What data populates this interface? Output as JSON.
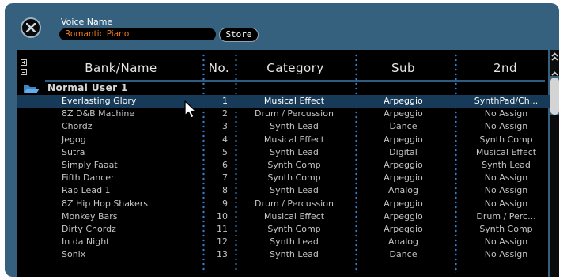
{
  "voice": {
    "label": "Voice Name",
    "value": "Romantic Piano",
    "store_label": "Store"
  },
  "columns": {
    "name": "Bank/Name",
    "no": "No.",
    "category": "Category",
    "sub": "Sub",
    "second": "2nd"
  },
  "group": {
    "label": "Normal User 1"
  },
  "rows": [
    {
      "name": "Everlasting Glory",
      "no": "1",
      "category": "Musical Effect",
      "sub": "Arpeggio",
      "second": "SynthPad/Ch..."
    },
    {
      "name": "8Z D&B Machine",
      "no": "2",
      "category": "Drum / Percussion",
      "sub": "Arpeggio",
      "second": "No Assign"
    },
    {
      "name": "Chordz",
      "no": "3",
      "category": "Synth Lead",
      "sub": "Dance",
      "second": "No Assign"
    },
    {
      "name": "Jegog",
      "no": "4",
      "category": "Musical Effect",
      "sub": "Arpeggio",
      "second": "Synth Comp"
    },
    {
      "name": "Sutra",
      "no": "5",
      "category": "Synth Lead",
      "sub": "Digital",
      "second": "Musical Effect"
    },
    {
      "name": "Simply Faaat",
      "no": "6",
      "category": "Synth Comp",
      "sub": "Arpeggio",
      "second": "Synth Lead"
    },
    {
      "name": "Fifth Dancer",
      "no": "7",
      "category": "Synth Comp",
      "sub": "Arpeggio",
      "second": "No Assign"
    },
    {
      "name": "Rap Lead 1",
      "no": "8",
      "category": "Synth Lead",
      "sub": "Analog",
      "second": "No Assign"
    },
    {
      "name": "8Z Hip Hop Shakers",
      "no": "9",
      "category": "Drum / Percussion",
      "sub": "Arpeggio",
      "second": "No Assign"
    },
    {
      "name": "Monkey Bars",
      "no": "10",
      "category": "Musical Effect",
      "sub": "Arpeggio",
      "second": "Drum / Perc..."
    },
    {
      "name": "Dirty Chordz",
      "no": "11",
      "category": "Synth Comp",
      "sub": "Arpeggio",
      "second": "Synth Comp"
    },
    {
      "name": "In da Night",
      "no": "12",
      "category": "Synth Lead",
      "sub": "Analog",
      "second": "No Assign"
    },
    {
      "name": "Sonix",
      "no": "13",
      "category": "Synth Lead",
      "sub": "Dance",
      "second": "No Assign"
    }
  ],
  "selected_row": 0,
  "icons": {
    "close": "close-x-icon",
    "folder": "folder-open-icon",
    "cursor": "mouse-pointer-icon"
  },
  "colors": {
    "window_bg": "#35607e",
    "voice_name_text": "#f07a1e",
    "selected_row": "#163a57",
    "separator_dots": "#2f80c9"
  }
}
